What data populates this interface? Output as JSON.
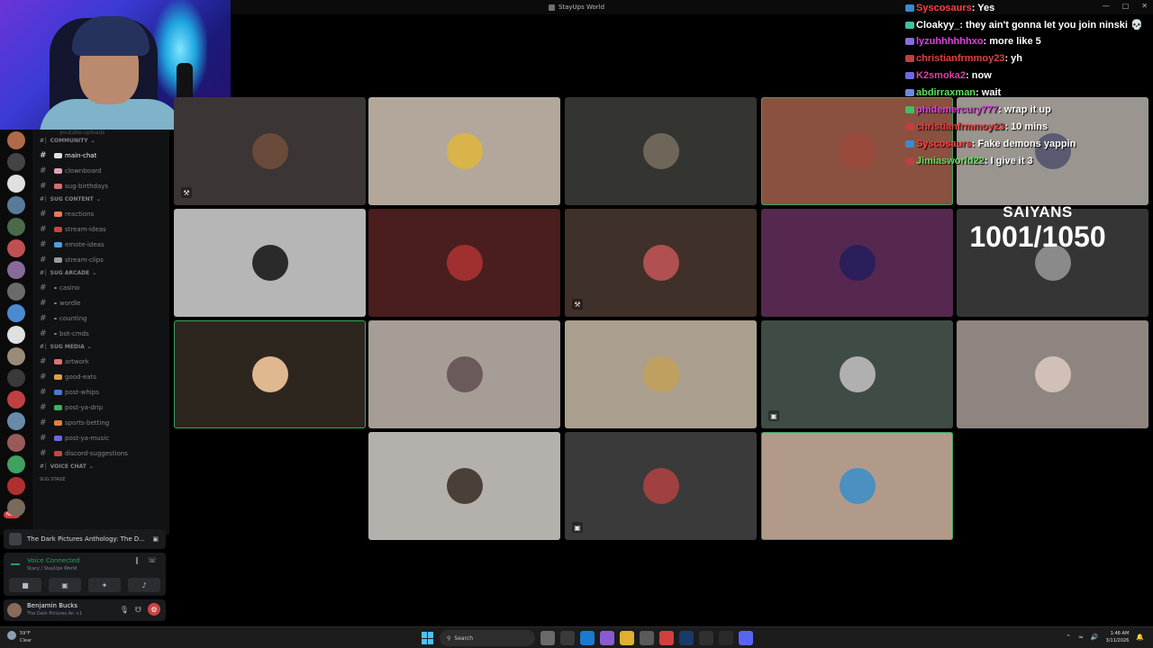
{
  "window": {
    "title": "StayUps World",
    "controls": [
      "—",
      "□",
      "✕"
    ]
  },
  "channels": [
    {
      "type": "trunc",
      "label": "youtube-uploads"
    },
    {
      "type": "cat",
      "label": "COMMUNITY"
    },
    {
      "type": "ch",
      "label": "main-chat",
      "color": "#e0e0e0",
      "active": true
    },
    {
      "type": "ch",
      "label": "clownboard",
      "color": "#e0a0c0"
    },
    {
      "type": "ch",
      "label": "sug-birthdays",
      "color": "#d07070"
    },
    {
      "type": "cat",
      "label": "SUG CONTENT"
    },
    {
      "type": "ch",
      "label": "reactions",
      "color": "#e87a5a"
    },
    {
      "type": "ch",
      "label": "stream-ideas",
      "color": "#d04040"
    },
    {
      "type": "ch",
      "label": "emote-ideas",
      "color": "#4aa0e0"
    },
    {
      "type": "ch",
      "label": "stream-clips",
      "color": "#9a9aa0"
    },
    {
      "type": "cat",
      "label": "SUG ARCADE"
    },
    {
      "type": "ch",
      "label": "casino",
      "color": ""
    },
    {
      "type": "ch",
      "label": "wordle",
      "color": ""
    },
    {
      "type": "ch",
      "label": "counting",
      "color": ""
    },
    {
      "type": "ch",
      "label": "bot-cmds",
      "color": ""
    },
    {
      "type": "cat",
      "label": "SUG MEDIA"
    },
    {
      "type": "ch",
      "label": "artwork",
      "color": "#e07070"
    },
    {
      "type": "ch",
      "label": "good-eats",
      "color": "#e0a040"
    },
    {
      "type": "ch",
      "label": "post-whips",
      "color": "#4a7ad0"
    },
    {
      "type": "ch",
      "label": "post-ya-drip",
      "color": "#40b060"
    },
    {
      "type": "ch",
      "label": "sports-betting",
      "color": "#e08040"
    },
    {
      "type": "ch",
      "label": "post-ya-music",
      "color": "#6a6ae0"
    },
    {
      "type": "ch",
      "label": "discord-suggestions",
      "color": "#d04040"
    },
    {
      "type": "cat",
      "label": "VOICE CHAT"
    },
    {
      "type": "stage",
      "label": "SUG STAGE"
    }
  ],
  "servers": [
    {
      "color": "#b06a4a",
      "badge": ""
    },
    {
      "color": "#444",
      "badge": ""
    },
    {
      "color": "#e0e0e0",
      "badge": ""
    },
    {
      "color": "#5a7a9a",
      "badge": ""
    },
    {
      "color": "#4a6a4a",
      "badge": ""
    },
    {
      "color": "#c05050",
      "badge": ""
    },
    {
      "color": "#8a6a9a",
      "badge": ""
    },
    {
      "color": "#6a6a6a",
      "badge": ""
    },
    {
      "color": "#4a8ad0",
      "badge": ""
    },
    {
      "color": "#e0e0e0",
      "badge": ""
    },
    {
      "color": "#9a8a7a",
      "badge": ""
    },
    {
      "color": "#3a3a3a",
      "badge": ""
    },
    {
      "color": "#c04040",
      "badge": ""
    },
    {
      "color": "#6a8aaa",
      "badge": ""
    },
    {
      "color": "#9a5a5a",
      "badge": ""
    },
    {
      "color": "#40a060",
      "badge": ""
    },
    {
      "color": "#b03030",
      "badge": ""
    },
    {
      "color": "#7a6a5a",
      "badge": ""
    }
  ],
  "rail_new_badge": "NEW",
  "activity": {
    "text": "The Dark Pictures Anthology: The D..."
  },
  "voice": {
    "status": "Voice Connected",
    "sub": "Stacy / StayUps World"
  },
  "user": {
    "name": "Benjamin Bucks",
    "status": "The Dark Pictures An +1"
  },
  "tiles": [
    {
      "bg": "#3b3536",
      "avatar": "#6a4a3a",
      "icon": "⚒"
    },
    {
      "bg": "#b3a79b",
      "avatar": "#d9b44a",
      "icon": ""
    },
    {
      "bg": "#343431",
      "avatar": "#6f665a",
      "icon": ""
    },
    {
      "bg": "#8a5040",
      "avatar": "#9a4a3a",
      "icon": "",
      "speaking": true
    },
    {
      "bg": "#9a958f",
      "avatar": "#5a5a70",
      "icon": ""
    },
    {
      "bg": "#b6b6b6",
      "avatar": "#2a2a2a",
      "icon": ""
    },
    {
      "bg": "#4a1e1f",
      "avatar": "#a03030",
      "icon": ""
    },
    {
      "bg": "#3f302a",
      "avatar": "#b05050",
      "icon": "⚒"
    },
    {
      "bg": "#56284f",
      "avatar": "#2a1f5a",
      "icon": ""
    },
    {
      "bg": "#353535",
      "avatar": "#8a8a8a",
      "icon": ""
    },
    {
      "bg": "#2d261f",
      "avatar": "#e0b890",
      "icon": "",
      "speaking": true
    },
    {
      "bg": "#a59d96",
      "avatar": "#6a5a5a",
      "icon": ""
    },
    {
      "bg": "#aa9e8e",
      "avatar": "#c0a060",
      "icon": ""
    },
    {
      "bg": "#3f4c45",
      "avatar": "#b0b0b0",
      "icon": "▣"
    },
    {
      "bg": "#8f8580",
      "avatar": "#d0c0b8",
      "icon": ""
    },
    {
      "bg": "#b4b0ac",
      "avatar": "#4a4038",
      "icon": ""
    },
    {
      "bg": "#3a3a3a",
      "avatar": "#a04040",
      "icon": "▣"
    },
    {
      "bg": "#b29a8a",
      "avatar": "#4a90c0",
      "icon": "",
      "speaking": true
    }
  ],
  "counter": {
    "title": "SAIYANS",
    "value": "1001/1050"
  },
  "chat": [
    {
      "user": "Syscosaurs",
      "color": "#ff4040",
      "badge": "#3a8ad0",
      "text": "Yes"
    },
    {
      "user": "Cloakyy_",
      "color": "#ffffff",
      "badge": "#40c0a0",
      "text": "they ain't gonna let you join ninski 💀",
      "wrap": true
    },
    {
      "user": "lyzuhhhhhhxo",
      "color": "#e040e0",
      "badge": "#8a6ae0",
      "text": "more like 5"
    },
    {
      "user": "christianfrmmoy23",
      "color": "#e04040",
      "badge": "#c04040",
      "text": "yh"
    },
    {
      "user": "K2smoka2",
      "color": "#e040a0",
      "badge": "#6a6ae0",
      "text": "now"
    },
    {
      "user": "abdirraxman",
      "color": "#60e060",
      "badge": "#6a8ae0",
      "text": "wait"
    },
    {
      "user": "phidemercury777",
      "color": "#e040e0",
      "badge": "#40c060",
      "text": "wrap it up"
    },
    {
      "user": "christianfrmmoy23",
      "color": "#e04040",
      "badge": "#c04040",
      "text": "10 mins"
    },
    {
      "user": "Syscosaurs",
      "color": "#ff4040",
      "badge": "#3a8ad0",
      "text": "Fake demons yappin"
    },
    {
      "user": "Jimiasworld22",
      "color": "#60e060",
      "badge": "#c04040",
      "text": "I give it 3"
    }
  ],
  "taskbar": {
    "temp": "59°F",
    "weather": "Clear",
    "search": "Search",
    "time": "1:46 AM",
    "date": "3/11/2026",
    "apps": [
      {
        "name": "files-app",
        "color": "#6a6a6a"
      },
      {
        "name": "task-view",
        "color": "#3a3a3a"
      },
      {
        "name": "edge",
        "color": "#1a7ad0"
      },
      {
        "name": "copilot",
        "color": "#8a5ad0"
      },
      {
        "name": "explorer",
        "color": "#e0b030"
      },
      {
        "name": "settings",
        "color": "#5a5a5a"
      },
      {
        "name": "chrome",
        "color": "#d04040"
      },
      {
        "name": "steam",
        "color": "#1a3a6a"
      },
      {
        "name": "obs",
        "color": "#303030"
      },
      {
        "name": "capcut",
        "color": "#2a2a2a"
      },
      {
        "name": "discord",
        "color": "#5865f2"
      }
    ]
  }
}
